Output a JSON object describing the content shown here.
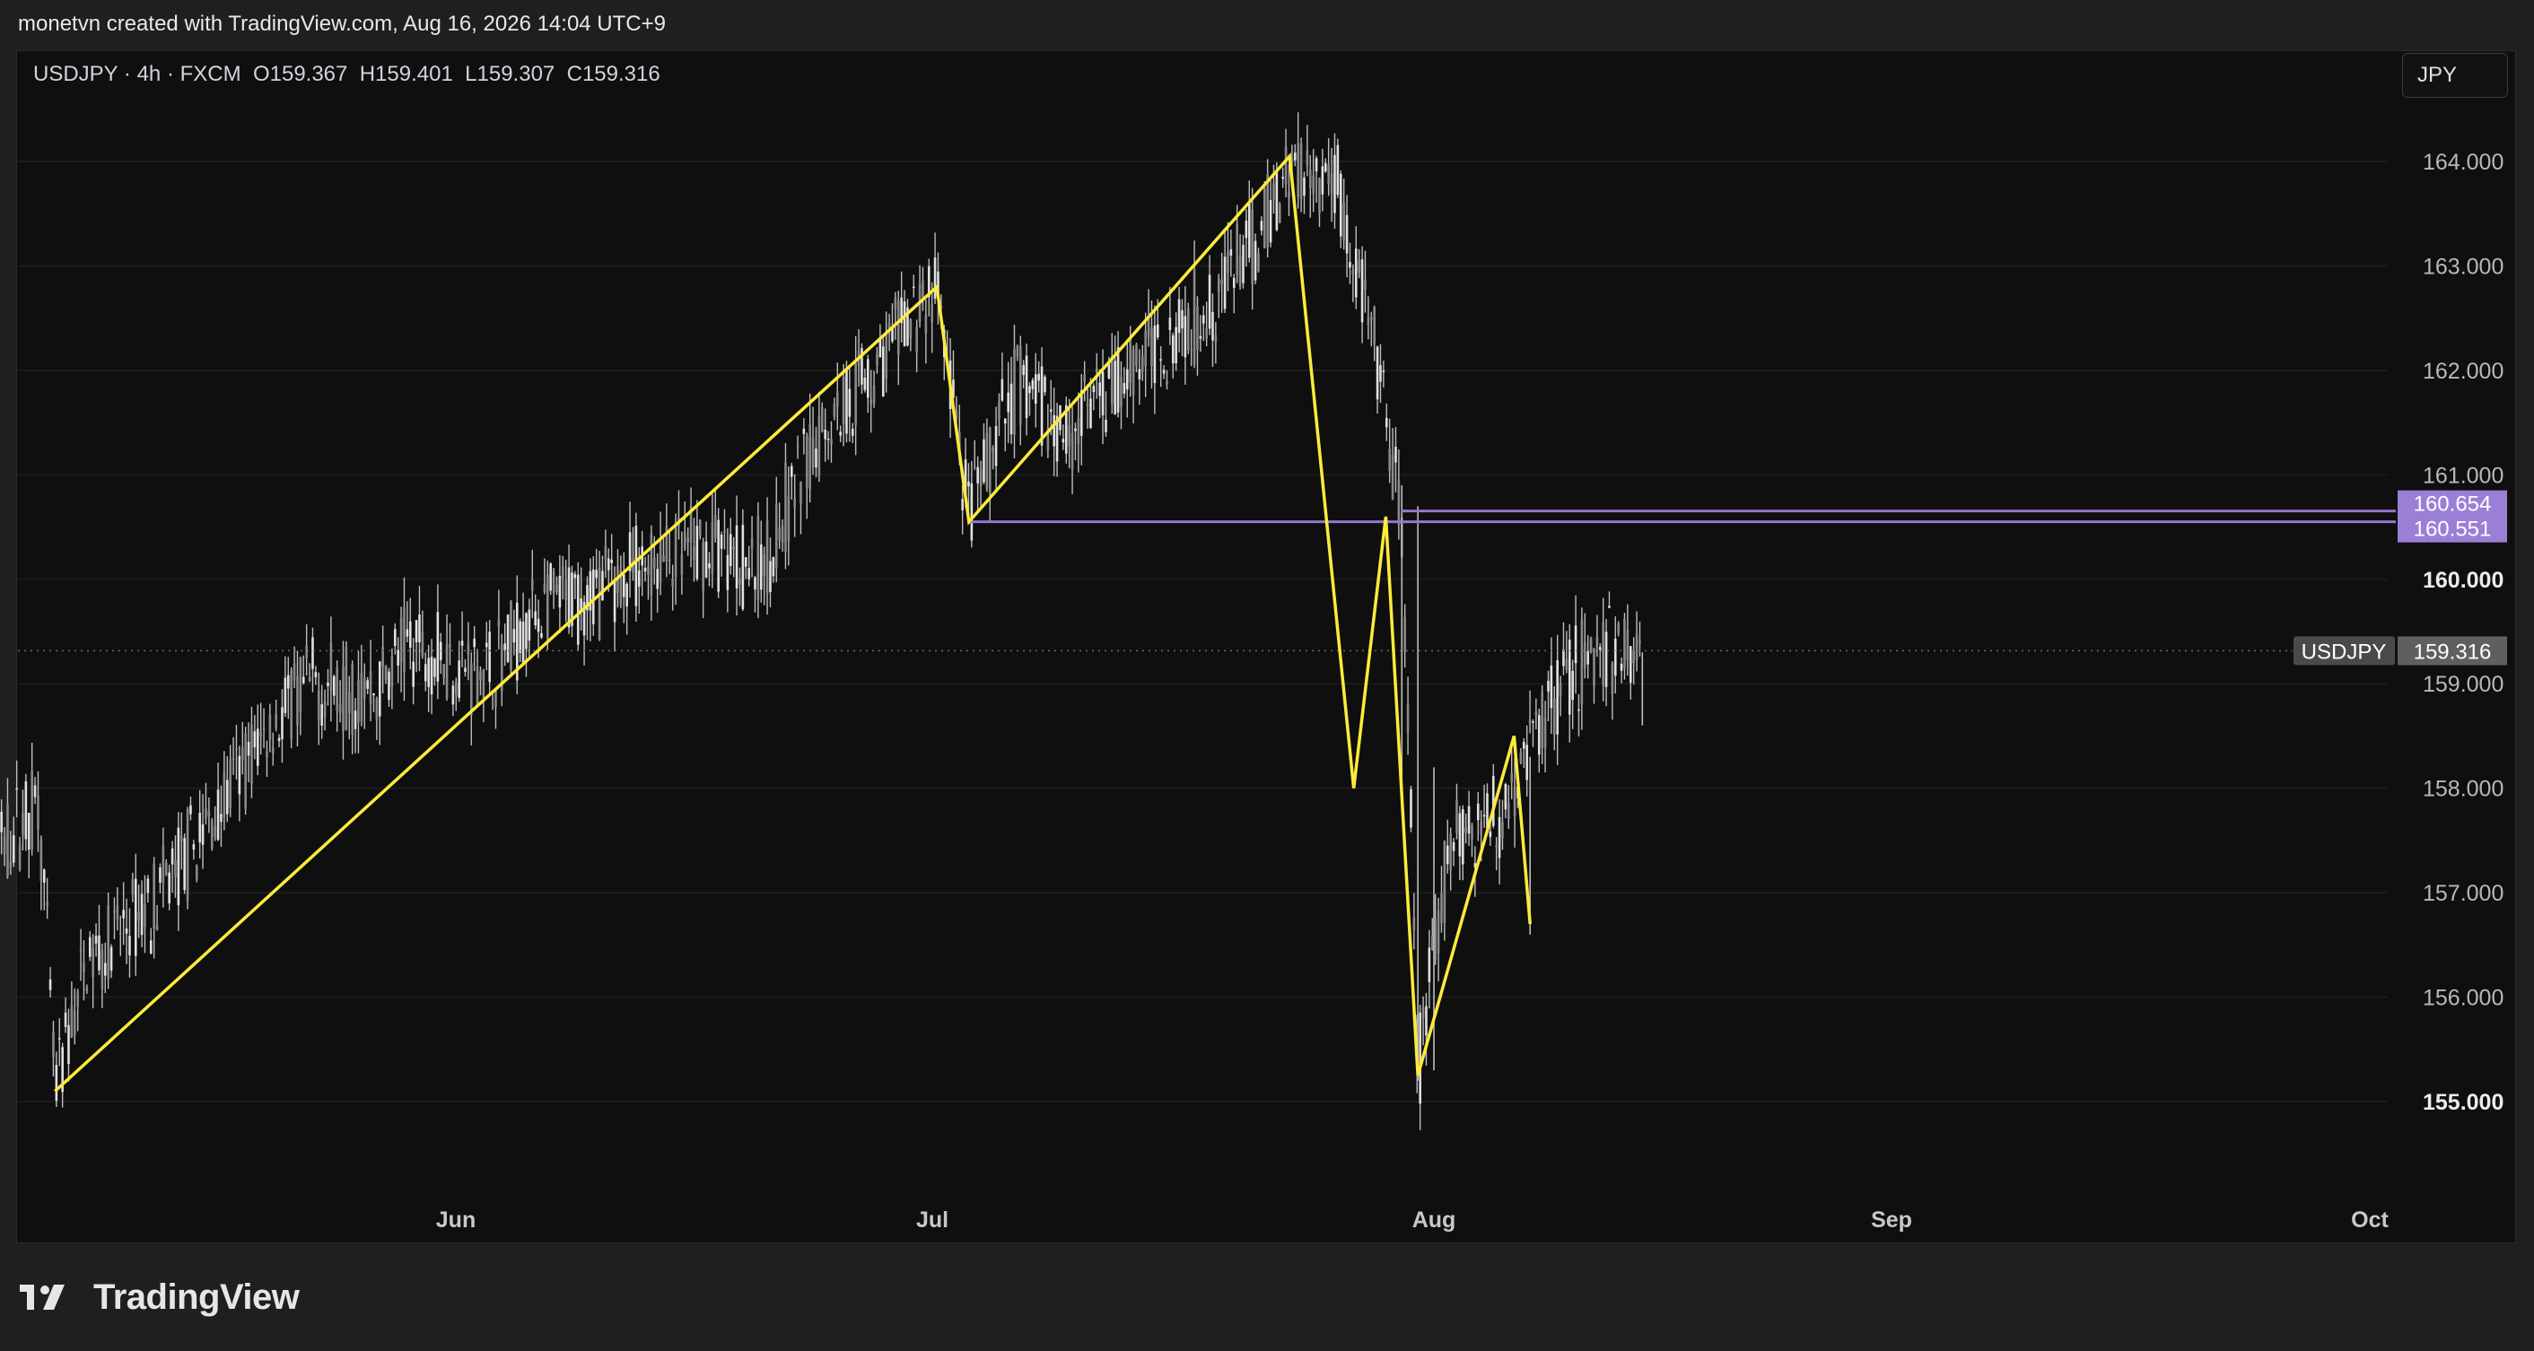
{
  "header": {
    "attribution": "monetvn created with TradingView.com, Aug 16, 2026 14:04 UTC+9"
  },
  "legend": {
    "symbol": "USDJPY · 4h · FXCM",
    "open": "O159.367",
    "high": "H159.401",
    "low": "L159.307",
    "close": "C159.316"
  },
  "currency_button": "JPY",
  "price_scale": {
    "ticks": [
      "164.000",
      "163.000",
      "162.000",
      "161.000",
      "160.000",
      "159.000",
      "158.000",
      "157.000",
      "156.000",
      "155.000"
    ],
    "bold_ticks": [
      "160.000",
      "155.000"
    ],
    "levels": [
      {
        "label": "160.654",
        "value": 160.654
      },
      {
        "label": "160.551",
        "value": 160.551
      }
    ],
    "current": {
      "symbol": "USDJPY",
      "label": "159.316",
      "value": 159.316
    }
  },
  "time_axis": {
    "labels": [
      "Jun",
      "Jul",
      "Aug",
      "Sep",
      "Oct"
    ]
  },
  "colors": {
    "zigzag": "#ffeb3b",
    "level_line": "#9575cd",
    "level_tag": "#9b7fd6",
    "candles": "#bdbdbd",
    "current_tag": "#5f5f5f"
  },
  "chart_data": {
    "type": "line",
    "title": "",
    "series": [
      {
        "x": [
          "May 7",
          "Jul 1",
          "Jul 3",
          "Jul 23",
          "Jul 27",
          "Jul 29",
          "Jul 31",
          "Aug 6",
          "Aug 7"
        ],
        "values": [
          155.1,
          162.8,
          160.55,
          164.05,
          158.0,
          160.6,
          155.25,
          158.5,
          156.7
        ]
      }
    ],
    "price_range": [
      154.9,
      164.2
    ],
    "price_points": [
      [
        "May 1",
        157.0
      ],
      [
        "May 3",
        157.3
      ],
      [
        "May 6",
        157.9
      ],
      [
        "May 7",
        155.1
      ],
      [
        "May 9",
        156.3
      ],
      [
        "May 13",
        156.9
      ],
      [
        "May 16",
        157.5
      ],
      [
        "May 20",
        158.5
      ],
      [
        "May 23",
        159.0
      ],
      [
        "May 27",
        158.9
      ],
      [
        "May 29",
        159.4
      ],
      [
        "Jun 3",
        159.1
      ],
      [
        "Jun 6",
        159.7
      ],
      [
        "Jun 10",
        159.9
      ],
      [
        "Jun 14",
        160.2
      ],
      [
        "Jun 17",
        160.3
      ],
      [
        "Jun 20",
        160.1
      ],
      [
        "Jun 24",
        161.5
      ],
      [
        "Jun 27",
        162.0
      ],
      [
        "Jul 1",
        162.8
      ],
      [
        "Jul 3",
        160.55
      ],
      [
        "Jul 6",
        161.9
      ],
      [
        "Jul 9",
        161.4
      ],
      [
        "Jul 13",
        162.0
      ],
      [
        "Jul 17",
        162.5
      ],
      [
        "Jul 21",
        163.2
      ],
      [
        "Jul 23",
        164.0
      ],
      [
        "Jul 26",
        163.8
      ],
      [
        "Jul 28",
        162.4
      ],
      [
        "Jul 30",
        160.5
      ],
      [
        "Jul 31",
        155.3
      ],
      [
        "Aug 2",
        157.5
      ],
      [
        "Aug 5",
        157.7
      ],
      [
        "Aug 7",
        158.4
      ],
      [
        "Aug 9",
        159.1
      ],
      [
        "Aug 12",
        159.3
      ],
      [
        "Aug 14",
        159.3
      ]
    ]
  },
  "branding": {
    "name": "TradingView"
  }
}
